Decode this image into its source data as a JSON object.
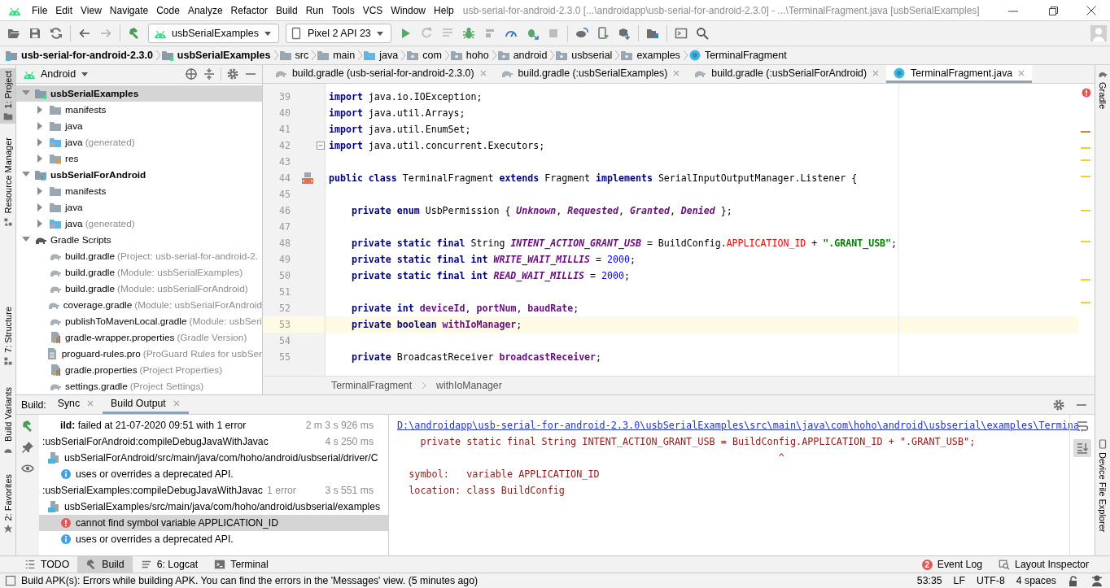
{
  "menu": [
    "File",
    "Edit",
    "View",
    "Navigate",
    "Code",
    "Analyze",
    "Refactor",
    "Build",
    "Run",
    "Tools",
    "VCS",
    "Window",
    "Help"
  ],
  "window_title": "usb-serial-for-android-2.3.0 [...\\androidapp\\usb-serial-for-android-2.3.0] - ...\\TerminalFragment.java [usbSerialExamples]",
  "toolbar": {
    "run_config": "usbSerialExamples",
    "device": "Pixel 2 API 23"
  },
  "breadcrumb": [
    {
      "label": "usb-serial-for-android-2.3.0",
      "kind": "project"
    },
    {
      "label": "usbSerialExamples",
      "kind": "module"
    },
    {
      "label": "src",
      "kind": "folder"
    },
    {
      "label": "main",
      "kind": "folder"
    },
    {
      "label": "java",
      "kind": "source"
    },
    {
      "label": "com",
      "kind": "package"
    },
    {
      "label": "hoho",
      "kind": "package"
    },
    {
      "label": "android",
      "kind": "package"
    },
    {
      "label": "usbserial",
      "kind": "package"
    },
    {
      "label": "examples",
      "kind": "package"
    },
    {
      "label": "TerminalFragment",
      "kind": "class"
    }
  ],
  "left_strip": [
    {
      "label": "1: Project",
      "selected": true
    },
    {
      "label": "Resource Manager",
      "selected": false
    },
    {
      "label": "7: Structure",
      "selected": false
    },
    {
      "label": "Build Variants",
      "selected": false
    },
    {
      "label": "2: Favorites",
      "selected": false
    }
  ],
  "project_panel": {
    "view": "Android",
    "tree": [
      {
        "label": "usbSerialExamples",
        "kind": "module",
        "expanded": true,
        "selected": true,
        "children": [
          {
            "label": "manifests",
            "kind": "folder",
            "expanded": false,
            "selected": false
          },
          {
            "label": "java",
            "kind": "folder",
            "expanded": false,
            "selected": false
          },
          {
            "label": "java",
            "hint": "(generated)",
            "kind": "generated",
            "expanded": false,
            "selected": false
          },
          {
            "label": "res",
            "kind": "res",
            "expanded": false,
            "selected": false
          }
        ]
      },
      {
        "label": "usbSerialForAndroid",
        "kind": "library",
        "expanded": true,
        "selected": false,
        "children": [
          {
            "label": "manifests",
            "kind": "folder",
            "expanded": false,
            "selected": false
          },
          {
            "label": "java",
            "kind": "folder",
            "expanded": false,
            "selected": false
          },
          {
            "label": "java",
            "hint": "(generated)",
            "kind": "generated",
            "expanded": false,
            "selected": false
          }
        ]
      },
      {
        "label": "Gradle Scripts",
        "kind": "scripts",
        "expanded": true,
        "selected": false,
        "children": [
          {
            "label": "build.gradle",
            "hint": "(Project: usb-serial-for-android-2.",
            "kind": "gradle",
            "selected": false
          },
          {
            "label": "build.gradle",
            "hint": "(Module: usbSerialExamples)",
            "kind": "gradle",
            "selected": false
          },
          {
            "label": "build.gradle",
            "hint": "(Module: usbSerialForAndroid)",
            "kind": "gradle",
            "selected": false
          },
          {
            "label": "coverage.gradle",
            "hint": "(Module: usbSerialForAndroid",
            "kind": "gradle",
            "selected": false
          },
          {
            "label": "publishToMavenLocal.gradle",
            "hint": "(Module: usbSeri",
            "kind": "gradle",
            "selected": false
          },
          {
            "label": "gradle-wrapper.properties",
            "hint": "(Gradle Version)",
            "kind": "properties",
            "selected": false
          },
          {
            "label": "proguard-rules.pro",
            "hint": "(ProGuard Rules for usbSer",
            "kind": "text",
            "selected": false
          },
          {
            "label": "gradle.properties",
            "hint": "(Project Properties)",
            "kind": "properties",
            "selected": false
          },
          {
            "label": "settings.gradle",
            "hint": "(Project Settings)",
            "kind": "gradle",
            "selected": false
          }
        ]
      }
    ]
  },
  "editor_tabs": [
    {
      "label": "build.gradle (usb-serial-for-android-2.3.0)",
      "kind": "gradle",
      "selected": false
    },
    {
      "label": "build.gradle (:usbSerialExamples)",
      "kind": "gradle",
      "selected": false
    },
    {
      "label": "build.gradle (:usbSerialForAndroid)",
      "kind": "gradle",
      "selected": false
    },
    {
      "label": "TerminalFragment.java",
      "kind": "class",
      "selected": true
    }
  ],
  "code_lines": [
    {
      "number": "39",
      "current": false,
      "segments": [
        {
          "kind": "keyword",
          "text": "import"
        },
        {
          "kind": "plain",
          "text": " java.io.IOException;"
        }
      ]
    },
    {
      "number": "40",
      "current": false,
      "segments": [
        {
          "kind": "keyword",
          "text": "import"
        },
        {
          "kind": "plain",
          "text": " java.util.Arrays;"
        }
      ]
    },
    {
      "number": "41",
      "current": false,
      "segments": [
        {
          "kind": "keyword",
          "text": "import"
        },
        {
          "kind": "plain",
          "text": " java.util.EnumSet;"
        }
      ]
    },
    {
      "number": "42",
      "current": false,
      "gutter": {
        "kind": "fold"
      },
      "segments": [
        {
          "kind": "keyword",
          "text": "import"
        },
        {
          "kind": "plain",
          "text": " java.util.concurrent.Executors;"
        }
      ]
    },
    {
      "number": "43",
      "current": false
    },
    {
      "number": "44",
      "current": false,
      "gutter": {
        "kind": "layout"
      },
      "segments": [
        {
          "kind": "keyword",
          "text": "public class"
        },
        {
          "kind": "plain",
          "text": " TerminalFragment "
        },
        {
          "kind": "keyword",
          "text": "extends"
        },
        {
          "kind": "plain",
          "text": " Fragment "
        },
        {
          "kind": "keyword",
          "text": "implements"
        },
        {
          "kind": "plain",
          "text": " SerialInputOutputManager.Listener {"
        }
      ]
    },
    {
      "number": "45",
      "current": false
    },
    {
      "number": "46",
      "current": false,
      "segments": [
        {
          "kind": "keyword",
          "text": "    private enum"
        },
        {
          "kind": "plain",
          "text": " UsbPermission { "
        },
        {
          "kind": "constant",
          "text": "Unknown"
        },
        {
          "kind": "plain",
          "text": ", "
        },
        {
          "kind": "constant",
          "text": "Requested"
        },
        {
          "kind": "plain",
          "text": ", "
        },
        {
          "kind": "constant",
          "text": "Granted"
        },
        {
          "kind": "plain",
          "text": ", "
        },
        {
          "kind": "constant",
          "text": "Denied"
        },
        {
          "kind": "plain",
          "text": " };"
        }
      ]
    },
    {
      "number": "47",
      "current": false
    },
    {
      "number": "48",
      "current": false,
      "segments": [
        {
          "kind": "keyword",
          "text": "    private static final"
        },
        {
          "kind": "plain",
          "text": " String "
        },
        {
          "kind": "constant",
          "text": "INTENT_ACTION_GRANT_USB"
        },
        {
          "kind": "plain",
          "text": " = BuildConfig."
        },
        {
          "kind": "error",
          "text": "APPLICATION_ID"
        },
        {
          "kind": "plain",
          "text": " + "
        },
        {
          "kind": "string",
          "text": "\".GRANT_USB\""
        },
        {
          "kind": "plain",
          "text": ";"
        }
      ]
    },
    {
      "number": "49",
      "current": false,
      "segments": [
        {
          "kind": "keyword",
          "text": "    private static final int "
        },
        {
          "kind": "constant",
          "text": "WRITE_WAIT_MILLIS"
        },
        {
          "kind": "plain",
          "text": " = "
        },
        {
          "kind": "number",
          "text": "2000"
        },
        {
          "kind": "plain",
          "text": ";"
        }
      ]
    },
    {
      "number": "50",
      "current": false,
      "segments": [
        {
          "kind": "keyword",
          "text": "    private static final int "
        },
        {
          "kind": "constant",
          "text": "READ_WAIT_MILLIS"
        },
        {
          "kind": "plain",
          "text": " = "
        },
        {
          "kind": "number",
          "text": "2000"
        },
        {
          "kind": "plain",
          "text": ";"
        }
      ]
    },
    {
      "number": "51",
      "current": false
    },
    {
      "number": "52",
      "current": false,
      "segments": [
        {
          "kind": "keyword",
          "text": "    private int "
        },
        {
          "kind": "field",
          "text": "deviceId"
        },
        {
          "kind": "plain",
          "text": ", "
        },
        {
          "kind": "field",
          "text": "portNum"
        },
        {
          "kind": "plain",
          "text": ", "
        },
        {
          "kind": "field",
          "text": "baudRate"
        },
        {
          "kind": "plain",
          "text": ";"
        }
      ]
    },
    {
      "number": "53",
      "current": true,
      "segments": [
        {
          "kind": "keyword",
          "text": "    private boolean "
        },
        {
          "kind": "field",
          "text": "withIoManager"
        },
        {
          "kind": "plain",
          "text": ";"
        }
      ]
    },
    {
      "number": "54",
      "current": false
    },
    {
      "number": "55",
      "current": false,
      "segments": [
        {
          "kind": "keyword",
          "text": "    private"
        },
        {
          "kind": "plain",
          "text": " BroadcastReceiver "
        },
        {
          "kind": "field",
          "text": "broadcastReceiver"
        },
        {
          "kind": "plain",
          "text": ";"
        }
      ]
    }
  ],
  "editor_breadcrumb": [
    "TerminalFragment",
    "withIoManager"
  ],
  "right_strip": [
    {
      "label": "Gradle"
    },
    {
      "label": "Device File Explorer"
    }
  ],
  "build_panel": {
    "title": "Build:",
    "tabs": [
      {
        "label": "Sync",
        "selected": false
      },
      {
        "label": "Build Output",
        "selected": true
      }
    ],
    "tree": [
      {
        "text": "**ild:** failed at 21-07-2020 09:51 with 1 error",
        "time": "2 m 3 s 926 ms",
        "selected": false,
        "children": [
          {
            "text": ":usbSerialForAndroid:compileDebugJavaWithJavac",
            "time": "4 s 250 ms",
            "selected": false,
            "children": [
              {
                "text": "usbSerialForAndroid/src/main/java/com/hoho/android/usbserial/driver/C",
                "kind": "file",
                "selected": false,
                "children": [
                  {
                    "text": "uses or overrides a deprecated API.",
                    "kind": "info",
                    "selected": false
                  }
                ]
              }
            ]
          },
          {
            "text": ":usbSerialExamples:compileDebugJavaWithJavac",
            "note": "1 error",
            "time": "3 s 551 ms",
            "selected": false,
            "children": [
              {
                "text": "usbSerialExamples/src/main/java/com/hoho/android/usbserial/examples",
                "kind": "file",
                "selected": false,
                "children": [
                  {
                    "text": "cannot find symbol variable APPLICATION_ID",
                    "kind": "error",
                    "selected": true
                  },
                  {
                    "text": "uses or overrides a deprecated API.",
                    "kind": "info",
                    "selected": false
                  }
                ]
              }
            ]
          }
        ]
      }
    ],
    "output": {
      "link": "D:\\androidapp\\usb-serial-for-android-2.3.0\\usbSerialExamples\\src\\main\\java\\com\\hoho\\android\\usbserial\\examples\\Termina",
      "lines": [
        "    private static final String INTENT_ACTION_GRANT_USB = BuildConfig.APPLICATION_ID + \".GRANT_USB\";",
        "                                                                  ^",
        "  symbol:   variable APPLICATION_ID",
        "  location: class BuildConfig"
      ]
    }
  },
  "tool_windows": [
    {
      "label": "TODO",
      "kind": "list",
      "selected": false
    },
    {
      "label": "Build",
      "kind": "hammer",
      "selected": true
    },
    {
      "label": "6: Logcat",
      "kind": "lines",
      "selected": false
    },
    {
      "label": "Terminal",
      "kind": "terminal",
      "selected": false
    }
  ],
  "event_log": {
    "label": "Event Log",
    "count": "2"
  },
  "layout_inspector": {
    "label": "Layout Inspector"
  },
  "status_bar": {
    "message": "Build APK(s): Errors while building APK. You can find the errors in the 'Messages' view. (5 minutes ago)",
    "position": "53:35",
    "line_separator": "LF",
    "encoding": "UTF-8",
    "indent": "4 spaces"
  }
}
